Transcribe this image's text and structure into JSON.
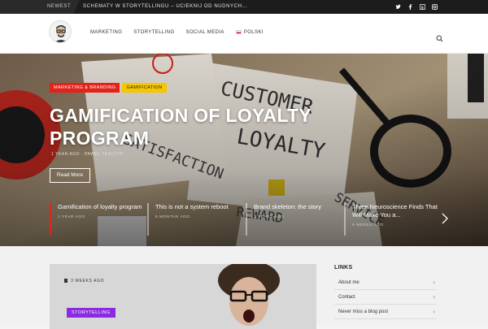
{
  "topbar": {
    "newest_label": "NEWEST",
    "ticker": "SCHEMATY W STORYTELLINGU – UCIEKNIJ OD NUDNYCH...",
    "social_icons": [
      "twitter-icon",
      "facebook-icon",
      "google-plus-icon",
      "instagram-icon"
    ]
  },
  "header": {
    "nav": [
      "MARKETING",
      "STORYTELLING",
      "SOCIAL MEDIA",
      "POLSKI"
    ]
  },
  "hero": {
    "categories": [
      "MARKETING & BRANDING",
      "GAMIFICATION"
    ],
    "title": "GAMIFICATION OF LOYALTY PROGRAM",
    "meta": "1 YEAR AGO · PAWEŁ TKACZYK",
    "read_more": "Read More",
    "slides": [
      {
        "title": "Gamification of loyalty program",
        "meta": "1 YEAR AGO"
      },
      {
        "title": "This is not a system reboot",
        "meta": "8 MONTHS AGO"
      },
      {
        "title": "Brand skeleton: the story",
        "meta": "2 YEARS AGO"
      },
      {
        "title": "Three Neuroscience Finds That Will Make You a...",
        "meta": "6 WEEKS AGO"
      }
    ]
  },
  "featured_post": {
    "meta": "3 WEEKS AGO",
    "category": "STORYTELLING"
  },
  "links": {
    "title": "LINKS",
    "items": [
      "About me",
      "Contact",
      "Never miss a blog post"
    ]
  },
  "colors": {
    "accent_red": "#e2231a",
    "accent_yellow": "#f6c700",
    "accent_purple": "#8a2be2"
  }
}
